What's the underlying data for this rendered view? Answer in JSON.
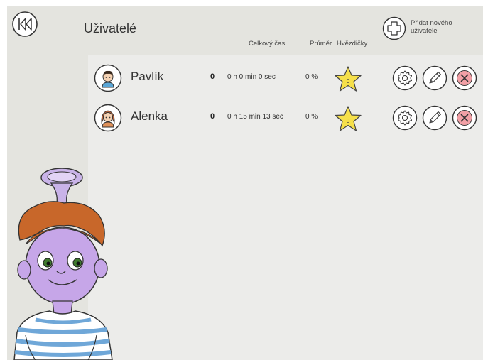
{
  "header": {
    "title": "Uživatelé",
    "add_user_label": "Přidat nového uživatele"
  },
  "columns": {
    "total_time": "Celkový čas",
    "average": "Průměr",
    "stars": "Hvězdičky"
  },
  "users": [
    {
      "name": "Pavlík",
      "score": "0",
      "time": "0 h 0 min 0 sec",
      "average": "0 %",
      "stars": "0",
      "avatar": "boy-avatar"
    },
    {
      "name": "Alenka",
      "score": "0",
      "time": "0 h 15 min 13 sec",
      "average": "0 %",
      "stars": "0",
      "avatar": "girl-avatar"
    }
  ],
  "colors": {
    "background": "#e4e4df",
    "panel": "#ececea",
    "star_fill": "#f6e04a",
    "delete_fill": "#f2a0a6"
  },
  "icons": [
    "back-icon",
    "plus-icon",
    "gear-icon",
    "pencil-icon",
    "delete-icon",
    "star-icon"
  ]
}
